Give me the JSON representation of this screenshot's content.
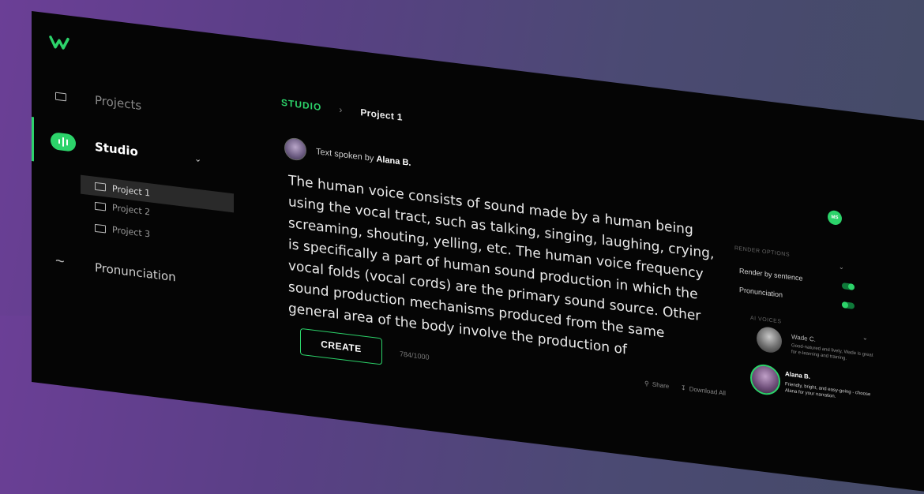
{
  "sidebar": {
    "items": [
      {
        "label": "Projects",
        "icon": "folder-icon"
      },
      {
        "label": "Studio",
        "icon": "waveform-icon"
      },
      {
        "label": "Pronunciation",
        "icon": "tilde-icon"
      }
    ],
    "projects": [
      "Project 1",
      "Project 2",
      "Project 3"
    ]
  },
  "breadcrumb": {
    "section": "STUDIO",
    "page": "Project 1"
  },
  "speaker": {
    "prefix": "Text spoken by",
    "name": "Alana B."
  },
  "editor": {
    "text": "The human voice consists of sound made by a human being using the vocal tract, such as talking, singing, laughing, crying, screaming, shouting, yelling, etc. The human voice frequency is specifically a part of human sound production in which the vocal folds (vocal cords) are the primary sound source. Other sound production mechanisms produced from the same general area of the body involve the production of"
  },
  "actions": {
    "create_label": "CREATE",
    "char_count": "784/1000",
    "share_label": "Share",
    "download_label": "Download All"
  },
  "user": {
    "initials": "MS"
  },
  "render_options": {
    "heading": "RENDER OPTIONS",
    "items": [
      {
        "label": "Render by sentence",
        "on": true
      },
      {
        "label": "Pronunciation",
        "on": false
      }
    ]
  },
  "voices": {
    "heading": "AI VOICES",
    "items": [
      {
        "name": "Wade C.",
        "desc": "Good-natured and lively, Wade is great for e-learning and training.",
        "selected": false
      },
      {
        "name": "Alana B.",
        "desc": "Friendly, bright, and easy-going - choose Alana for your narration.",
        "selected": true
      }
    ]
  },
  "colors": {
    "accent": "#2cd36a",
    "app_bg": "#050505"
  }
}
